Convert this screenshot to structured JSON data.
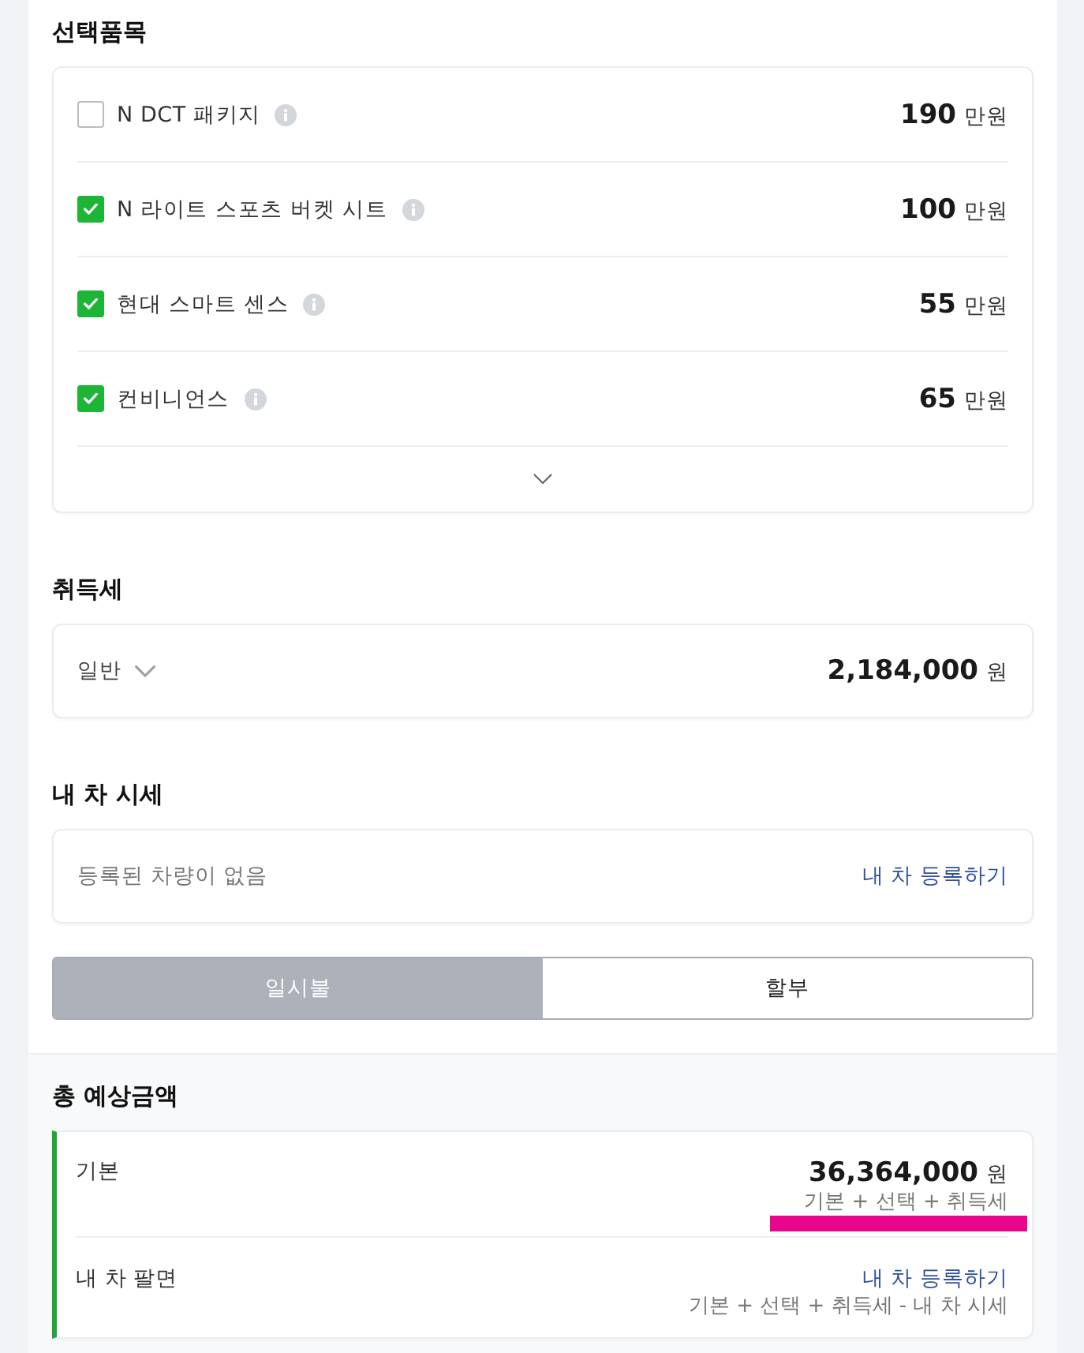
{
  "options": {
    "title": "선택품목",
    "expanded": false,
    "items": [
      {
        "label": "N DCT 패키지",
        "checked": false,
        "amount": "190",
        "unit": "만원"
      },
      {
        "label": "N 라이트 스포츠 버켓 시트",
        "checked": true,
        "amount": "100",
        "unit": "만원"
      },
      {
        "label": "현대 스마트 센스",
        "checked": true,
        "amount": "55",
        "unit": "만원"
      },
      {
        "label": "컨비니언스",
        "checked": true,
        "amount": "65",
        "unit": "만원"
      }
    ]
  },
  "tax": {
    "title": "취득세",
    "type": "일반",
    "amount": "2,184,000",
    "unit": "원"
  },
  "trade_in": {
    "title": "내 차 시세",
    "message": "등록된 차량이 없음",
    "link": "내 차 등록하기"
  },
  "payment_tabs": [
    {
      "label": "일시불",
      "selected": true
    },
    {
      "label": "할부",
      "selected": false
    }
  ],
  "total": {
    "title": "총 예상금액",
    "rows": [
      {
        "kind": "amount",
        "label": "기본",
        "amount": "36,364,000",
        "unit": "원",
        "formula": "기본 + 선택 + 취득세",
        "highlighted": true
      },
      {
        "kind": "link",
        "label": "내 차 팔면",
        "link": "내 차 등록하기",
        "formula": "기본 + 선택 + 취득세 - 내 차 시세",
        "highlighted": false
      }
    ]
  }
}
